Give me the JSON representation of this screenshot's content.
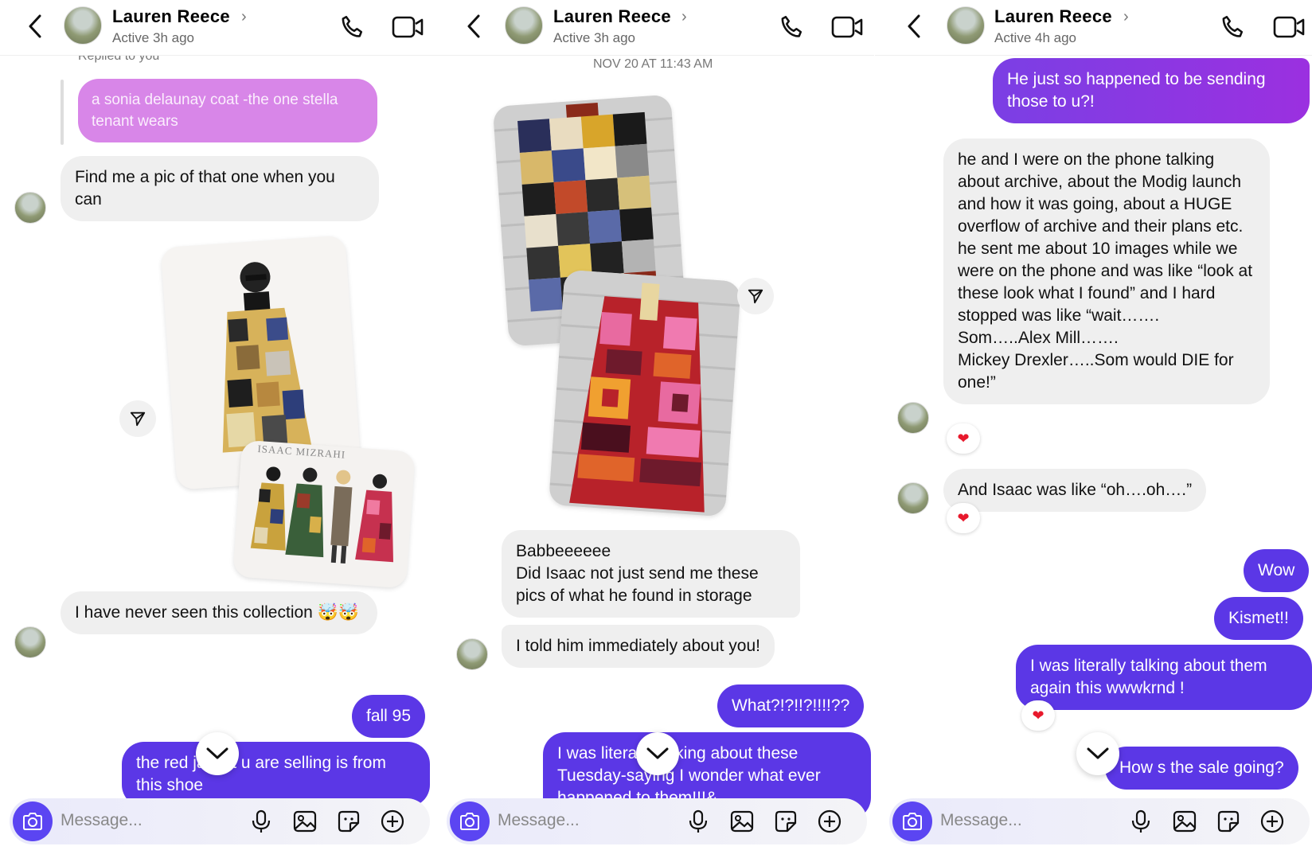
{
  "panels": [
    {
      "header": {
        "name": "Lauren Reece",
        "status": "Active 3h ago"
      },
      "replied_label": "Replied to you",
      "reply_quote": "a sonia delaunay coat -the one stella tenant wears",
      "messages": [
        {
          "text": "Find me a pic of that one when you can"
        },
        {
          "text": "I have never seen this collection 🤯🤯"
        },
        {
          "text": "fall 95"
        },
        {
          "text": "the red jacket u are selling is from this shoe"
        }
      ],
      "photo_caption": "ISAAC MIZRAHI",
      "composer_placeholder": "Message..."
    },
    {
      "header": {
        "name": "Lauren Reece",
        "status": "Active 3h ago"
      },
      "timestamp": "NOV 20 AT 11:43 AM",
      "messages": [
        {
          "text": "Babbeeeeee\nDid Isaac not just send me these pics of what he found in storage"
        },
        {
          "text": "I told him immediately about you!"
        },
        {
          "text": "What?!?!!?!!!!??"
        },
        {
          "text": "I was literally talking about these Tuesday-saying  I wonder what ever happened to them!!!&"
        }
      ],
      "composer_placeholder": "Message..."
    },
    {
      "header": {
        "name": "Lauren Reece",
        "status": "Active 4h ago"
      },
      "messages": [
        {
          "text": "He just so happened to be sending those to u?!"
        },
        {
          "text": " he and I were on the phone talking about archive, about the Modig launch and how it was going, about a HUGE overflow of archive and their plans etc.\n he sent me about 10 images while we were on the phone and was like “look at these look what I found” and I hard stopped was like “wait……. Som…..Alex Mill…….\nMickey Drexler…..Som would DIE for one!”"
        },
        {
          "text": "And Isaac was like “oh….oh….”"
        },
        {
          "text": "Wow"
        },
        {
          "text": "Kismet!!"
        },
        {
          "text": "I was literally talking about them again this wwwkrnd !"
        },
        {
          "text": "How s the sale going?"
        }
      ],
      "composer_placeholder": "Message..."
    }
  ],
  "icons": [
    "back-arrow-icon",
    "phone-icon",
    "video-icon",
    "share-icon",
    "heart-icon",
    "chevron-down-icon",
    "camera-icon",
    "mic-icon",
    "gallery-icon",
    "sticker-icon",
    "plus-icon"
  ],
  "colors": {
    "outgoing": "#5b37e6",
    "incoming": "#efefef",
    "reply": "#d886e8",
    "heart": "#e8192c"
  }
}
